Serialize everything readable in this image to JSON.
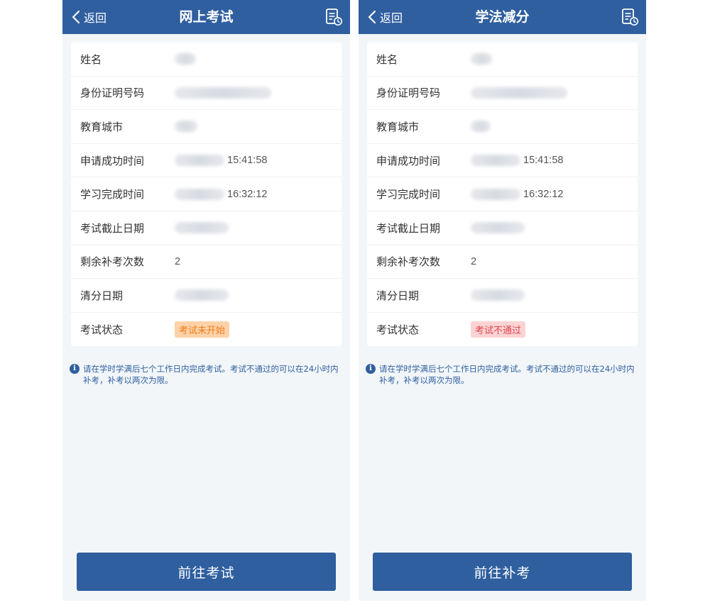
{
  "colors": {
    "brand": "#2f5f9f",
    "page_bg": "#f2f6f9",
    "badge_orange_bg": "#fdd2a8",
    "badge_orange_text": "#f07a1a",
    "badge_red_bg": "#fbd3d4",
    "badge_red_text": "#e0454b"
  },
  "left": {
    "header": {
      "back_label": "返回",
      "title": "网上考试",
      "back_icon": "chevron-left-icon",
      "doc_icon": "document-clock-icon"
    },
    "fields": {
      "name_label": "姓名",
      "id_label": "身份证明号码",
      "city_label": "教育城市",
      "apply_label": "申请成功时间",
      "apply_time": "15:41:58",
      "study_label": "学习完成时间",
      "study_time": "16:32:12",
      "deadline_label": "考试截止日期",
      "remaining_label": "剩余补考次数",
      "remaining_value": "2",
      "clear_label": "清分日期",
      "status_label": "考试状态",
      "status_value": "考试未开始"
    },
    "notice": "请在学时学满后七个工作日内完成考试。考试不通过的可以在24小时内补考，补考以两次为限。",
    "button_label": "前往考试"
  },
  "right": {
    "header": {
      "back_label": "返回",
      "title": "学法减分",
      "back_icon": "chevron-left-icon",
      "doc_icon": "document-clock-icon"
    },
    "fields": {
      "name_label": "姓名",
      "id_label": "身份证明号码",
      "city_label": "教育城市",
      "apply_label": "申请成功时间",
      "apply_time": "15:41:58",
      "study_label": "学习完成时间",
      "study_time": "16:32:12",
      "deadline_label": "考试截止日期",
      "remaining_label": "剩余补考次数",
      "remaining_value": "2",
      "clear_label": "清分日期",
      "status_label": "考试状态",
      "status_value": "考试不通过"
    },
    "notice": "请在学时学满后七个工作日内完成考试。考试不通过的可以在24小时内补考，补考以两次为限。",
    "button_label": "前往补考"
  }
}
